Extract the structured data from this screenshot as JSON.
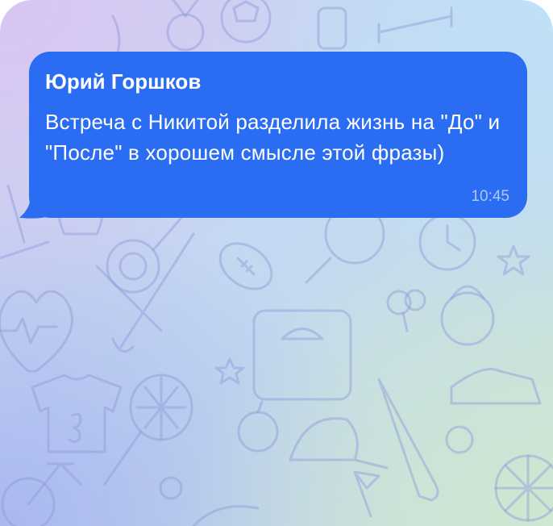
{
  "chat": {
    "message": {
      "sender": "Юрий Горшков",
      "text": "Встреча с Никитой разделила жизнь на \"До\" и \"После\" в хорошем смысле этой фразы)",
      "time": "10:45"
    }
  },
  "colors": {
    "bubble": "#2a6df2",
    "text": "#ffffff",
    "pattern": "#8f9ad6"
  },
  "background_icons": [
    "sports-pattern"
  ]
}
